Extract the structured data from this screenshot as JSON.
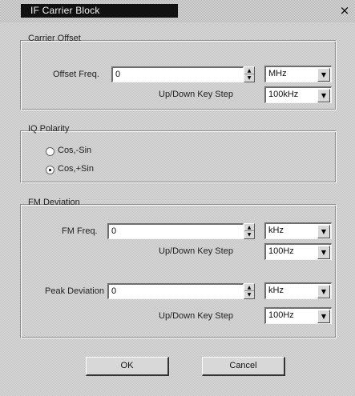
{
  "window": {
    "title": "IF Carrier Block",
    "close_glyph": "×"
  },
  "carrier_offset": {
    "group_label": "Carrier Offset",
    "offset_freq_label": "Offset Freq.",
    "offset_freq_value": "0",
    "offset_unit": "MHz",
    "updown_label": "Up/Down Key Step",
    "updown_value": "100kHz"
  },
  "iq_polarity": {
    "group_label": "IQ Polarity",
    "options": [
      {
        "label": "Cos,-Sin",
        "selected": false
      },
      {
        "label": "Cos,+Sin",
        "selected": true
      }
    ]
  },
  "fm_deviation": {
    "group_label": "FM Deviation",
    "fm_freq_label": "FM Freq.",
    "fm_freq_value": "0",
    "fm_freq_unit": "kHz",
    "fm_updown_label": "Up/Down Key Step",
    "fm_updown_value": "100Hz",
    "peak_dev_label": "Peak Deviation",
    "peak_dev_value": "0",
    "peak_dev_unit": "kHz",
    "peak_updown_label": "Up/Down Key Step",
    "peak_updown_value": "100Hz"
  },
  "buttons": {
    "ok": "OK",
    "cancel": "Cancel"
  },
  "icons": {
    "spin_up": "▲",
    "spin_down": "▼",
    "dropdown": "▼"
  }
}
